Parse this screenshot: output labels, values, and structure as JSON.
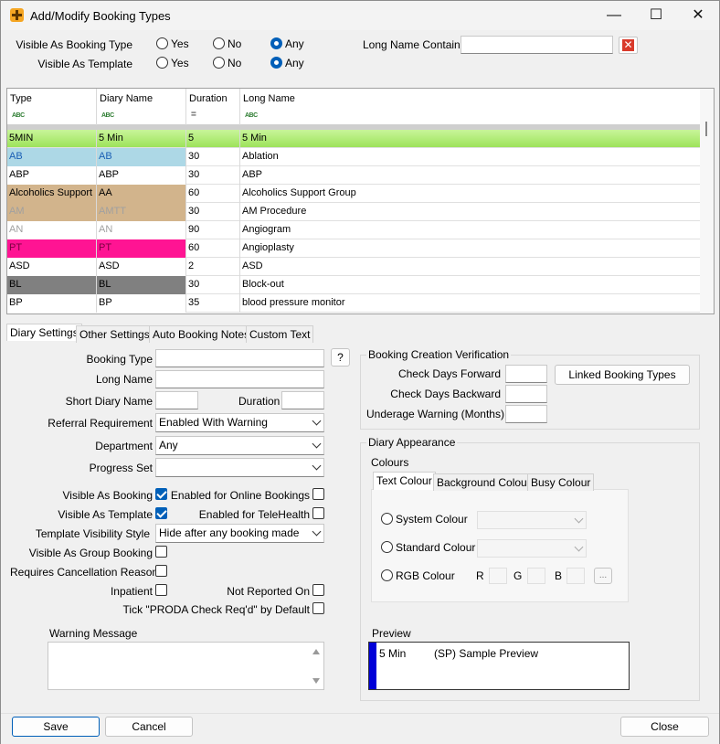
{
  "window": {
    "title": "Add/Modify Booking Types",
    "minimize": "—",
    "maximize": "☐",
    "close": "✕"
  },
  "filters": {
    "visible_as_booking_type_label": "Visible As Booking Type",
    "visible_as_template_label": "Visible As Template",
    "yes": "Yes",
    "no": "No",
    "any": "Any",
    "booking_type_selected": "Any",
    "template_selected": "Any",
    "long_name_contains_label": "Long Name Contains",
    "long_name_contains_value": ""
  },
  "grid": {
    "columns": [
      {
        "label": "Type",
        "filter": "ABC"
      },
      {
        "label": "Diary Name",
        "filter": "ABC"
      },
      {
        "label": "Duration",
        "filter": "="
      },
      {
        "label": "Long Name",
        "filter": "ABC"
      }
    ],
    "rows": [
      {
        "type": "5MIN",
        "diary": "5 Min",
        "duration": "5",
        "long": "5 Min",
        "bg": "#9de35a",
        "fg": "#000000",
        "full": true
      },
      {
        "type": "AB",
        "diary": "AB",
        "duration": "30",
        "long": "Ablation",
        "bg": "#add8e6",
        "fg": "#1a5fb4",
        "full": false
      },
      {
        "type": "ABP",
        "diary": "ABP",
        "duration": "30",
        "long": "ABP",
        "bg": "#ffffff",
        "fg": "#000000",
        "full": false
      },
      {
        "type": "Alcoholics Support",
        "diary": "AA",
        "duration": "60",
        "long": "Alcoholics Support Group",
        "bg": "#d2b48c",
        "fg": "#000000",
        "full": false
      },
      {
        "type": "AM",
        "diary": "AMTT",
        "duration": "30",
        "long": "AM Procedure",
        "bg": "#d2b48c",
        "fg": "#a0a0a0",
        "full": false
      },
      {
        "type": "AN",
        "diary": "AN",
        "duration": "90",
        "long": "Angiogram",
        "bg": "#ffffff",
        "fg": "#a0a0a0",
        "full": false
      },
      {
        "type": "PT",
        "diary": "PT",
        "duration": "60",
        "long": "Angioplasty",
        "bg": "#ff1493",
        "fg": "#7a0040",
        "full": false
      },
      {
        "type": "ASD",
        "diary": "ASD",
        "duration": "2",
        "long": "ASD",
        "bg": "#ffffff",
        "fg": "#000000",
        "full": false
      },
      {
        "type": "BL",
        "diary": "BL",
        "duration": "30",
        "long": "Block-out",
        "bg": "#808080",
        "fg": "#000000",
        "full": false
      },
      {
        "type": "BP",
        "diary": "BP",
        "duration": "35",
        "long": "blood pressure monitor",
        "bg": "#ffffff",
        "fg": "#000000",
        "full": false
      }
    ]
  },
  "tabs": [
    "Diary Settings",
    "Other Settings",
    "Auto Booking Notes",
    "Custom Text"
  ],
  "form": {
    "booking_type": "Booking Type",
    "help": "?",
    "long_name": "Long Name",
    "short_diary_name": "Short Diary Name",
    "duration": "Duration",
    "referral_requirement": "Referral Requirement",
    "referral_value": "Enabled With Warning",
    "department": "Department",
    "department_value": "Any",
    "progress_set": "Progress Set",
    "progress_value": "",
    "visible_as_booking": "Visible As Booking",
    "enabled_online": "Enabled for Online Bookings",
    "visible_as_template": "Visible As Template",
    "enabled_telehealth": "Enabled for TeleHealth",
    "template_visibility_style": "Template Visibility Style",
    "template_visibility_value": "Hide after any booking made",
    "visible_as_group": "Visible As Group Booking",
    "requires_cancellation": "Requires Cancellation Reason",
    "inpatient": "Inpatient",
    "not_reported_on": "Not Reported On",
    "tick_proda": "Tick \"PRODA Check Req'd\" by Default",
    "warning_message": "Warning Message"
  },
  "verification": {
    "title": "Booking Creation Verification",
    "check_forward": "Check Days Forward",
    "check_backward": "Check Days Backward",
    "underage": "Underage Warning (Months)",
    "linked": "Linked Booking Types"
  },
  "appearance": {
    "title": "Diary Appearance",
    "colours": "Colours",
    "tabs": [
      "Text Colour",
      "Background Colour",
      "Busy Colour"
    ],
    "system_colour": "System Colour",
    "standard_colour": "Standard Colour",
    "rgb_colour": "RGB Colour",
    "r": "R",
    "g": "G",
    "b": "B",
    "ellipsis": "...",
    "preview": "Preview",
    "preview_time": "5 Min",
    "preview_text": "(SP) Sample Preview",
    "preview_bar_color": "#0000d8"
  },
  "buttons": {
    "save": "Save",
    "cancel": "Cancel",
    "close": "Close"
  }
}
